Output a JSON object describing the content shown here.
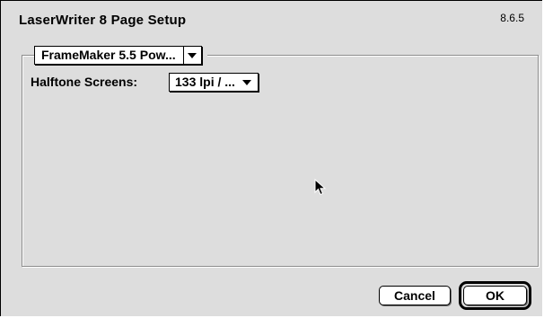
{
  "dialog": {
    "title": "LaserWriter 8 Page Setup",
    "version": "8.6.5"
  },
  "panel_selector": {
    "selected": "FrameMaker 5.5 Pow..."
  },
  "halftone": {
    "label": "Halftone Screens:",
    "selected": "133 lpi / ..."
  },
  "buttons": {
    "cancel_label": "Cancel",
    "ok_label": "OK"
  },
  "icons": {
    "popup_arrow": "triangle-down-icon",
    "cursor": "arrow-pointer-icon"
  }
}
